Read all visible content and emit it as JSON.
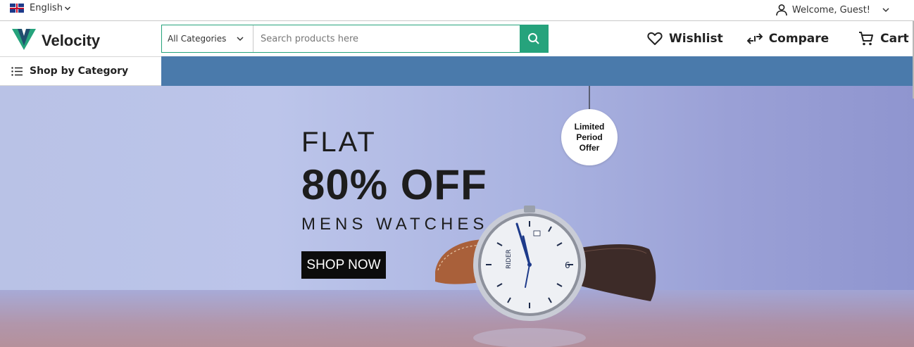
{
  "topbar": {
    "language": "English",
    "welcome": "Welcome, Guest!"
  },
  "header": {
    "logo_text": "Velocity",
    "search": {
      "category": "All Categories",
      "placeholder": "Search products here"
    },
    "wishlist_label": "Wishlist",
    "compare_label": "Compare",
    "cart_label": "Cart"
  },
  "category_bar": {
    "label": "Shop by Category"
  },
  "banner": {
    "line1": "FLAT",
    "line2": "80% OFF",
    "line3": "MENS WATCHES",
    "cta": "SHOP NOW",
    "tag": "Limited Period Offer",
    "watch_brand": "RIDER"
  },
  "colors": {
    "accent": "#26a37c",
    "bar": "#4a7aab"
  },
  "icons": [
    "flag-uk-icon",
    "chevron-down-icon",
    "user-icon",
    "velocity-logo-icon",
    "search-icon",
    "heart-icon",
    "compare-icon",
    "cart-icon",
    "menu-icon"
  ]
}
